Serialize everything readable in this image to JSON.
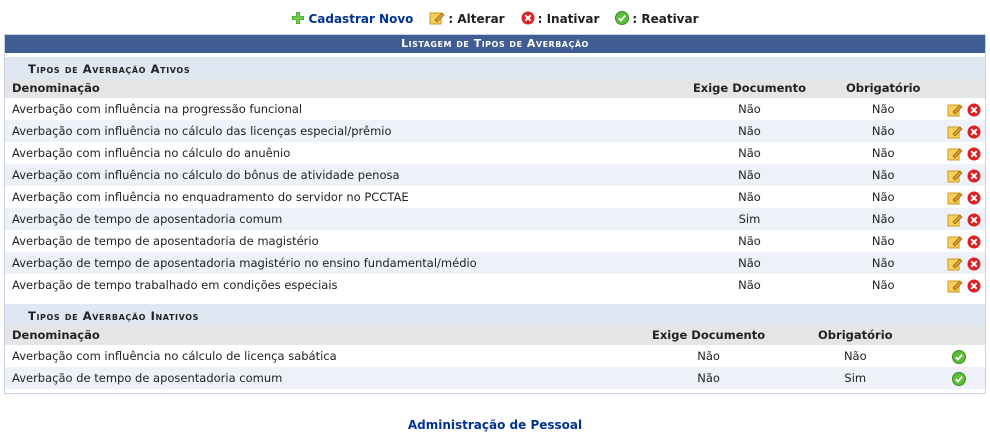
{
  "legend": {
    "cadastrar": "Cadastrar Novo",
    "alterar": ": Alterar",
    "inativar": ": Inativar",
    "reativar": ": Reativar"
  },
  "caption": "Listagem de Tipos de Averbação",
  "ativos": {
    "title": "Tipos de Averbação Ativos",
    "headers": {
      "name": "Denominação",
      "doc": "Exige Documento",
      "obr": "Obrigatório"
    },
    "rows": [
      {
        "name": "Averbação com influência na progressão funcional",
        "doc": "Não",
        "obr": "Não"
      },
      {
        "name": "Averbação com influência no cálculo das licenças especial/prêmio",
        "doc": "Não",
        "obr": "Não"
      },
      {
        "name": "Averbação com influência no cálculo do anuênio",
        "doc": "Não",
        "obr": "Não"
      },
      {
        "name": "Averbação com influência no cálculo do bônus de atividade penosa",
        "doc": "Não",
        "obr": "Não"
      },
      {
        "name": "Averbação com influência no enquadramento do servidor no PCCTAE",
        "doc": "Não",
        "obr": "Não"
      },
      {
        "name": "Averbação de tempo de aposentadoria comum",
        "doc": "Sim",
        "obr": "Não"
      },
      {
        "name": "Averbação de tempo de aposentadoria de magistério",
        "doc": "Não",
        "obr": "Não"
      },
      {
        "name": "Averbação de tempo de aposentadoria magistério no ensino fundamental/médio",
        "doc": "Não",
        "obr": "Não"
      },
      {
        "name": "Averbação de tempo trabalhado em condições especiais",
        "doc": "Não",
        "obr": "Não"
      }
    ]
  },
  "inativos": {
    "title": "Tipos de Averbação Inativos",
    "headers": {
      "name": "Denominação",
      "doc": "Exige Documento",
      "obr": "Obrigatório"
    },
    "rows": [
      {
        "name": "Averbação com influência no cálculo de licença sabática",
        "doc": "Não",
        "obr": "Não"
      },
      {
        "name": "Averbação de tempo de aposentadoria comum",
        "doc": "Não",
        "obr": "Sim"
      }
    ]
  },
  "footer": {
    "link": "Administração de Pessoal"
  },
  "icons": {
    "add": "plus-icon",
    "edit": "edit-icon",
    "delete": "delete-icon",
    "reactivate": "reactivate-icon"
  },
  "colors": {
    "caption_bg": "#3f5d93",
    "section_bg": "#dfe7f3",
    "link": "#003390"
  }
}
